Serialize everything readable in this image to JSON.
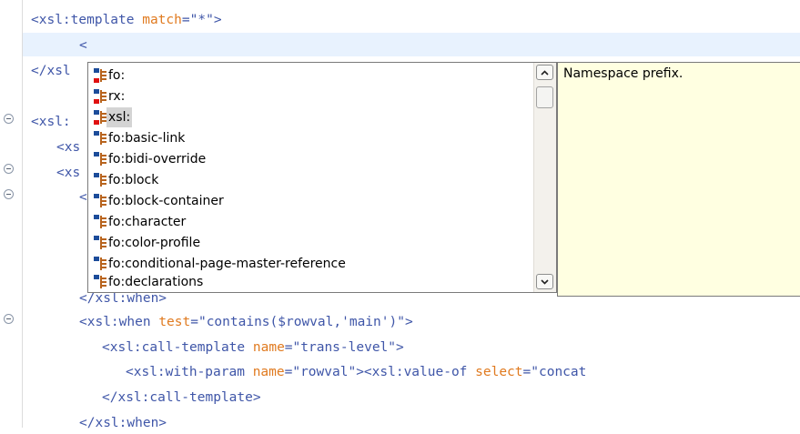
{
  "editor": {
    "colors": {
      "tag": "#3f56a8",
      "attribute": "#e07a1f",
      "value": "#3f56a8",
      "current_line": "#e8f2fe"
    },
    "lines": [
      {
        "tag_open": "<xsl:template ",
        "attr": "match",
        "eq": "=",
        "value": "\"*\"",
        "tag_close": ">"
      },
      {
        "text": "<"
      },
      {
        "text": "</xsl"
      },
      {
        "text": "<xsl:"
      },
      {
        "text": "<xs"
      },
      {
        "text": "<xs"
      },
      {
        "text": "<"
      },
      {
        "text": "</xsl:when>"
      },
      {
        "tag_open": "<xsl:when ",
        "attr": "test",
        "eq": "=",
        "value": "\"contains($rowval,'main')\"",
        "tag_close": ">"
      },
      {
        "tag_open": "<xsl:call-template ",
        "attr": "name",
        "eq": "=",
        "value": "\"trans-level\"",
        "tag_close": ">"
      },
      {
        "tag_open": "<xsl:with-param ",
        "attr": "name",
        "eq": "=",
        "value": "\"rowval\"",
        "tag_close": "><xsl:value-of ",
        "attr2": "select",
        "eq2": "=",
        "value2": "\"concat"
      },
      {
        "text": "</xsl:call-template>"
      },
      {
        "text": "</xsl:when>"
      }
    ]
  },
  "content_assist": {
    "items": [
      {
        "label": "fo:",
        "icon": "namespace-prefix-icon"
      },
      {
        "label": "rx:",
        "icon": "namespace-prefix-icon"
      },
      {
        "label": "xsl:",
        "icon": "namespace-prefix-icon",
        "selected": true
      },
      {
        "label": "fo:basic-link",
        "icon": "element-icon"
      },
      {
        "label": "fo:bidi-override",
        "icon": "element-icon"
      },
      {
        "label": "fo:block",
        "icon": "element-icon"
      },
      {
        "label": "fo:block-container",
        "icon": "element-icon"
      },
      {
        "label": "fo:character",
        "icon": "element-icon"
      },
      {
        "label": "fo:color-profile",
        "icon": "element-icon"
      },
      {
        "label": "fo:conditional-page-master-reference",
        "icon": "element-icon"
      },
      {
        "label": "fo:declarations",
        "icon": "element-icon"
      }
    ],
    "scroll_position": 0.02,
    "icon_colors": {
      "namespace_marker": "#e01010",
      "element_marker": "#1c4c9a",
      "bars": "#b8641e"
    }
  },
  "tooltip": {
    "text": "Namespace prefix.",
    "background": "#ffffe1"
  }
}
